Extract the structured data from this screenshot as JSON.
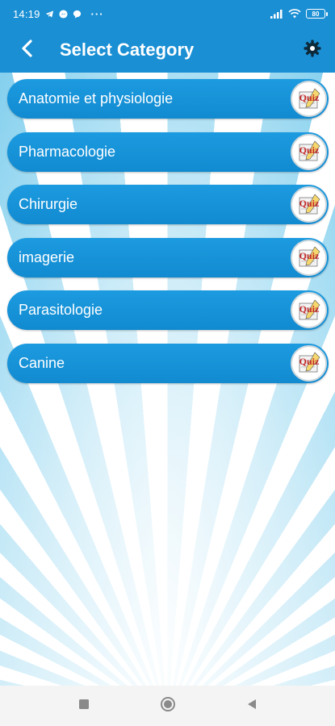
{
  "status_bar": {
    "time": "14:19",
    "dots": "···",
    "battery": "80",
    "icons": [
      "telegram-icon",
      "messenger-icon",
      "chat-bubble-icon",
      "signal-icon",
      "wifi-icon",
      "battery-icon"
    ]
  },
  "app_bar": {
    "title": "Select Category",
    "back_icon": "chevron-left-icon",
    "settings_icon": "gear-icon",
    "color": "#1a8fd4"
  },
  "categories": [
    {
      "label": "Anatomie et physiologie",
      "badge": "Quiz"
    },
    {
      "label": "Pharmacologie",
      "badge": "Quiz"
    },
    {
      "label": "Chirurgie",
      "badge": "Quiz"
    },
    {
      "label": "imagerie",
      "badge": "Quiz"
    },
    {
      "label": "Parasitologie",
      "badge": "Quiz"
    },
    {
      "label": "Canine",
      "badge": "Quiz"
    }
  ],
  "colors": {
    "primary": "#1a8fd4",
    "item_bg": "#1592d8",
    "ray": "#58bfe8",
    "quiz_red": "#c62828"
  },
  "nav_bar": {
    "icons": [
      "recent-apps-icon",
      "home-icon",
      "back-triangle-icon"
    ]
  }
}
